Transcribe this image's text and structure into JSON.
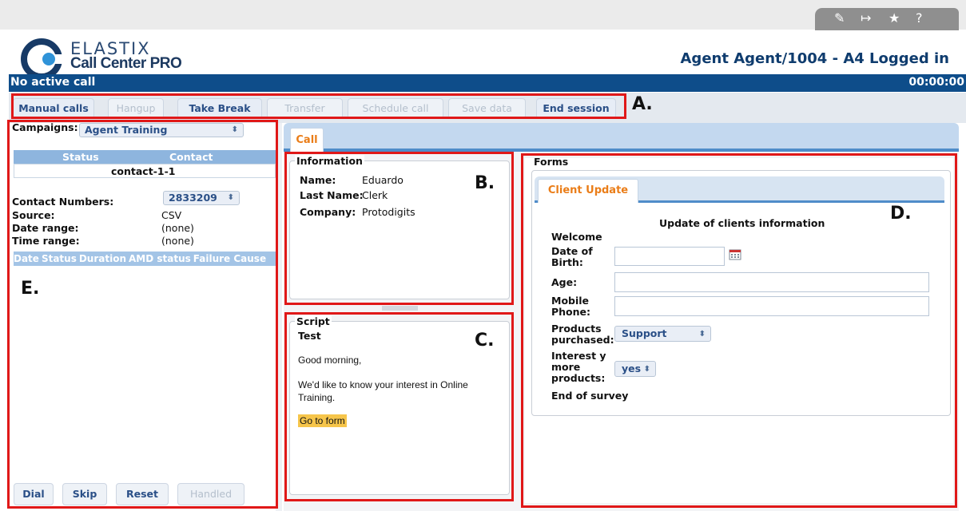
{
  "brand": {
    "line1": "ELASTIX",
    "line2": "Call Center PRO"
  },
  "agent_status": "Agent Agent/1004 - A4 Logged in",
  "call_bar": {
    "status": "No active call",
    "timer": "00:00:00"
  },
  "toolbar": {
    "buttons": [
      {
        "label": "Manual calls",
        "enabled": true
      },
      {
        "label": "Hangup",
        "enabled": false
      },
      {
        "label": "Take Break",
        "enabled": true
      },
      {
        "label": "Transfer",
        "enabled": false
      },
      {
        "label": "Schedule call",
        "enabled": false
      },
      {
        "label": "Save data",
        "enabled": false
      },
      {
        "label": "End session",
        "enabled": true
      }
    ]
  },
  "annotations": {
    "a": "A.",
    "b": "B.",
    "c": "C.",
    "d": "D.",
    "e": "E."
  },
  "left_panel": {
    "campaigns_label": "Campaigns:",
    "campaign_selected": "Agent Training",
    "status_header": "Status",
    "contact_header": "Contact",
    "contact_value": "contact-1-1",
    "contact_numbers_label": "Contact Numbers:",
    "contact_number_selected": "2833209",
    "source_label": "Source:",
    "source_value": "CSV",
    "date_range_label": "Date range:",
    "date_range_value": "(none)",
    "time_range_label": "Time range:",
    "time_range_value": "(none)",
    "history_columns": [
      "Date",
      "Status",
      "Duration",
      "AMD status",
      "Failure Cause"
    ],
    "buttons": [
      {
        "label": "Dial",
        "enabled": true
      },
      {
        "label": "Skip",
        "enabled": true
      },
      {
        "label": "Reset",
        "enabled": true
      },
      {
        "label": "Handled",
        "enabled": false
      }
    ]
  },
  "main_tab": "Call",
  "information": {
    "legend": "Information",
    "name_label": "Name:",
    "name_value": "Eduardo",
    "last_name_label": "Last Name:",
    "last_name_value": "Clerk",
    "company_label": "Company:",
    "company_value": "Protodigits"
  },
  "script": {
    "legend": "Script",
    "title": "Test",
    "line1": "Good morning,",
    "line2": "We'd like to know your interest in Online Training.",
    "link": "Go to form"
  },
  "forms": {
    "legend": "Forms",
    "tab": "Client Update",
    "heading": "Update of clients information",
    "welcome": "Welcome",
    "dob_label": "Date of Birth:",
    "age_label": "Age:",
    "mobile_label": "Mobile Phone:",
    "products_label": "Products purchased:",
    "products_selected": "Support",
    "interest_label": "Interest y more products:",
    "interest_selected": "yes",
    "end": "End of survey"
  }
}
